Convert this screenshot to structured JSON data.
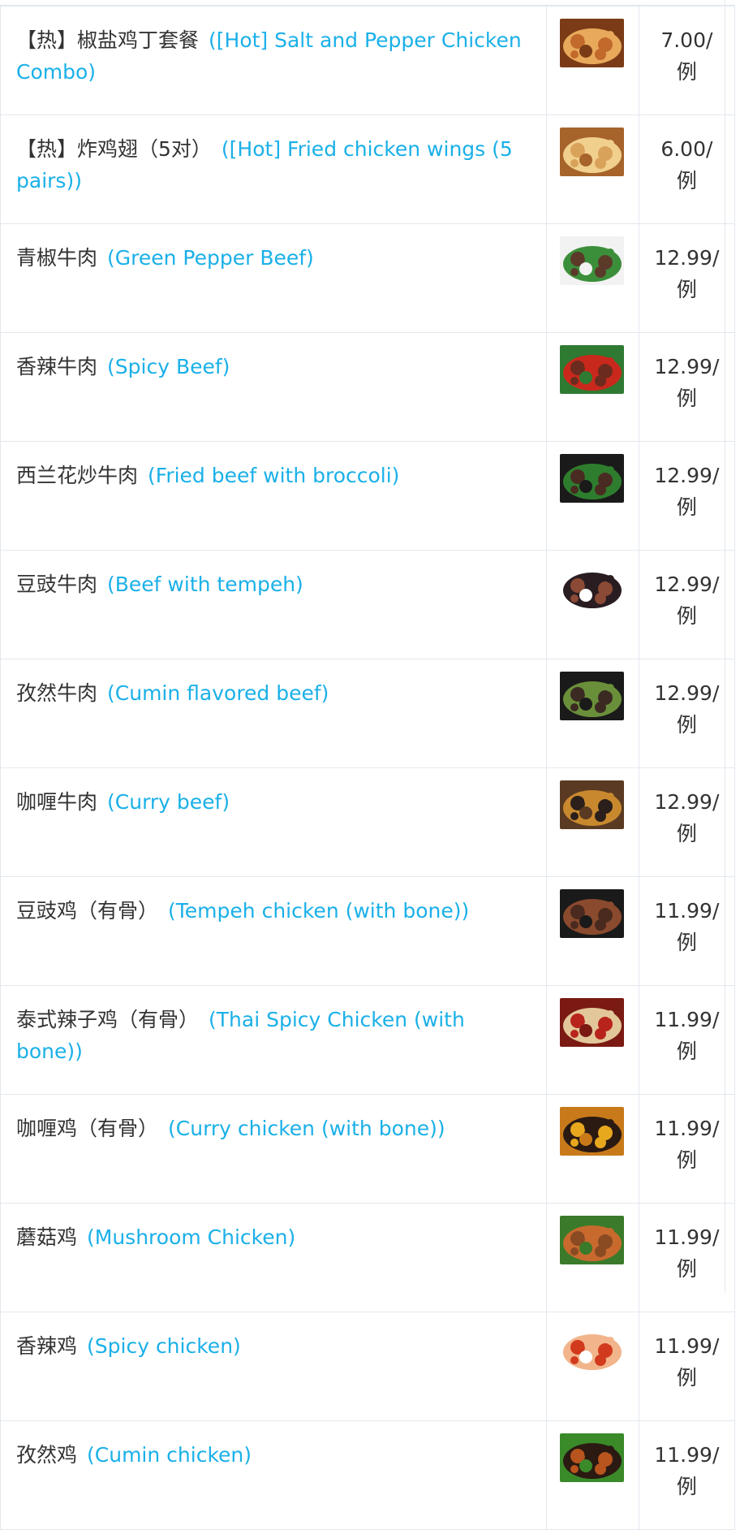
{
  "menu": {
    "items": [
      {
        "name_cn": "【热】椒盐鸡丁套餐",
        "name_en": "([Hot] Salt and Pepper Chicken Combo)",
        "price": "7.00/",
        "unit": "例",
        "image": {
          "icon": "fried-chicken-bites-photo",
          "colors": [
            "#c2692c",
            "#e8a95b",
            "#7a3b16"
          ]
        }
      },
      {
        "name_cn": "【热】炸鸡翅（5对）",
        "name_en": "([Hot] Fried chicken wings (5 pairs))",
        "price": "6.00/",
        "unit": "例",
        "image": {
          "icon": "fried-chicken-wings-photo",
          "colors": [
            "#d9a25a",
            "#f1cf8c",
            "#a6642a"
          ]
        }
      },
      {
        "name_cn": "青椒牛肉",
        "name_en": "(Green Pepper Beef)",
        "price": "12.99/",
        "unit": "例",
        "image": {
          "icon": "green-pepper-beef-photo",
          "colors": [
            "#5b3a2a",
            "#3c8f3a",
            "#f2f2f2"
          ]
        }
      },
      {
        "name_cn": "香辣牛肉",
        "name_en": "(Spicy Beef)",
        "price": "12.99/",
        "unit": "例",
        "image": {
          "icon": "spicy-beef-photo",
          "colors": [
            "#6b2b1e",
            "#c8291c",
            "#2f7a32"
          ]
        }
      },
      {
        "name_cn": "西兰花炒牛肉",
        "name_en": "(Fried beef with broccoli)",
        "price": "12.99/",
        "unit": "例",
        "image": {
          "icon": "beef-broccoli-photo",
          "colors": [
            "#4a2b22",
            "#2e7d2e",
            "#1a1a1a"
          ]
        }
      },
      {
        "name_cn": "豆豉牛肉",
        "name_en": "(Beef with tempeh)",
        "price": "12.99/",
        "unit": "例",
        "image": {
          "icon": "beef-tempeh-photo",
          "colors": [
            "#8b4a36",
            "#2a1d22",
            "#ffffff"
          ]
        }
      },
      {
        "name_cn": "孜然牛肉",
        "name_en": "(Cumin flavored beef)",
        "price": "12.99/",
        "unit": "例",
        "image": {
          "icon": "cumin-beef-photo",
          "colors": [
            "#3b2a22",
            "#6a8f3a",
            "#1a1a1a"
          ]
        }
      },
      {
        "name_cn": "咖喱牛肉",
        "name_en": "(Curry beef)",
        "price": "12.99/",
        "unit": "例",
        "image": {
          "icon": "curry-beef-photo",
          "colors": [
            "#2a1f1a",
            "#c8892e",
            "#5a3a22"
          ]
        }
      },
      {
        "name_cn": "豆豉鸡（有骨）",
        "name_en": "(Tempeh chicken (with bone))",
        "price": "11.99/",
        "unit": "例",
        "image": {
          "icon": "tempeh-chicken-photo",
          "colors": [
            "#4a2a1e",
            "#8a4a2e",
            "#1a1a1a"
          ]
        }
      },
      {
        "name_cn": "泰式辣子鸡（有骨）",
        "name_en": "(Thai Spicy Chicken (with bone))",
        "price": "11.99/",
        "unit": "例",
        "image": {
          "icon": "thai-spicy-chicken-photo",
          "colors": [
            "#b8241c",
            "#e2c79a",
            "#7a1a12"
          ]
        }
      },
      {
        "name_cn": "咖喱鸡（有骨）",
        "name_en": "(Curry chicken (with bone))",
        "price": "11.99/",
        "unit": "例",
        "image": {
          "icon": "curry-chicken-photo",
          "colors": [
            "#e8a81e",
            "#2a1a12",
            "#c87a1a"
          ]
        }
      },
      {
        "name_cn": "蘑菇鸡",
        "name_en": "(Mushroom Chicken)",
        "price": "11.99/",
        "unit": "例",
        "image": {
          "icon": "mushroom-chicken-photo",
          "colors": [
            "#8a4a22",
            "#c86a2e",
            "#3a7a2a"
          ]
        }
      },
      {
        "name_cn": "香辣鸡",
        "name_en": "(Spicy chicken)",
        "price": "11.99/",
        "unit": "例",
        "image": {
          "icon": "spicy-chicken-photo",
          "colors": [
            "#d23a1e",
            "#f2b48a",
            "#ffffff"
          ]
        }
      },
      {
        "name_cn": "孜然鸡",
        "name_en": "(Cumin chicken)",
        "price": "11.99/",
        "unit": "例",
        "image": {
          "icon": "cumin-chicken-photo",
          "colors": [
            "#b8541e",
            "#2a1a12",
            "#3a8a2a"
          ]
        }
      }
    ]
  }
}
